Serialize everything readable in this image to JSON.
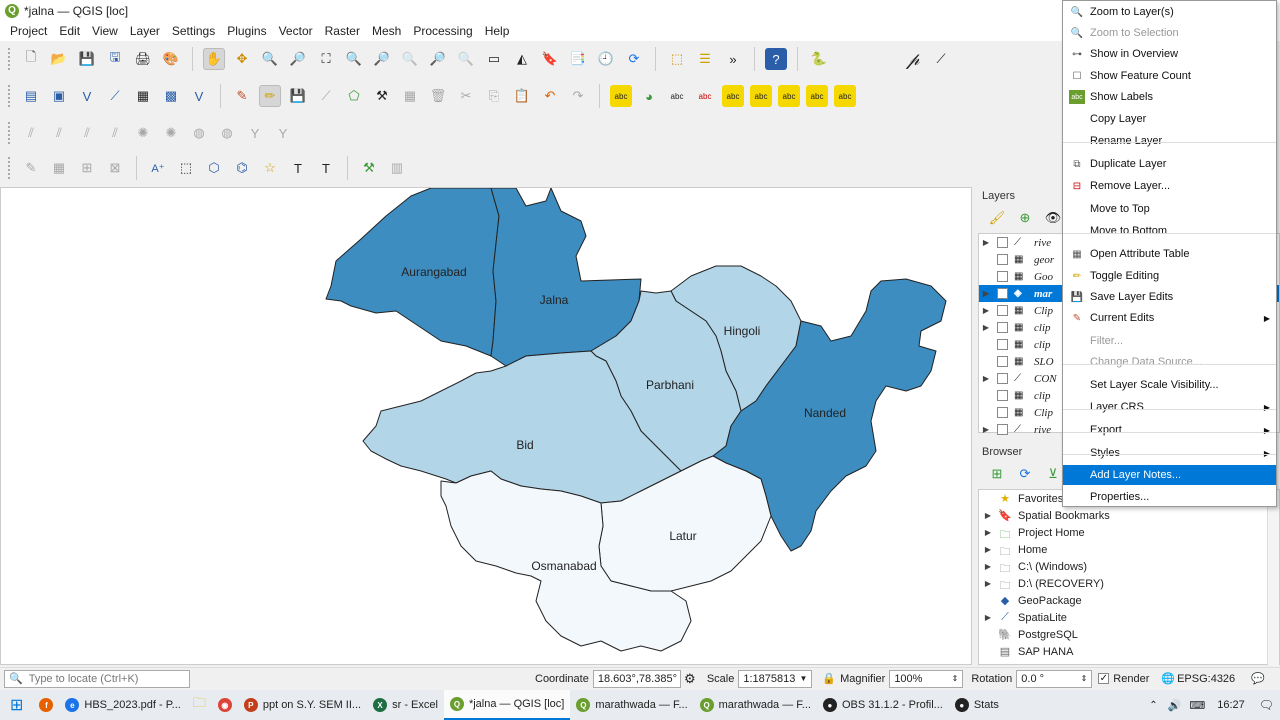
{
  "window": {
    "title": "*jalna — QGIS [loc]"
  },
  "menu": [
    "Project",
    "Edit",
    "View",
    "Layer",
    "Settings",
    "Plugins",
    "Vector",
    "Raster",
    "Mesh",
    "Processing",
    "Help"
  ],
  "map": {
    "districts": [
      {
        "name": "Aurangabad",
        "color": "#3d8dc0"
      },
      {
        "name": "Jalna",
        "color": "#3d8dc0"
      },
      {
        "name": "Hingoli",
        "color": "#b3d5e8"
      },
      {
        "name": "Parbhani",
        "color": "#b3d5e8"
      },
      {
        "name": "Nanded",
        "color": "#3d8dc0"
      },
      {
        "name": "Bid",
        "color": "#b3d5e8"
      },
      {
        "name": "Latur",
        "color": "#f3f8fc"
      },
      {
        "name": "Osmanabad",
        "color": "#f3f8fc"
      }
    ]
  },
  "layers": {
    "title": "Layers",
    "items": [
      {
        "name": "rive",
        "checked": false,
        "expand": true,
        "icon": "line"
      },
      {
        "name": "geor",
        "checked": false,
        "expand": false,
        "icon": "raster"
      },
      {
        "name": "Goo",
        "checked": false,
        "expand": false,
        "icon": "raster"
      },
      {
        "name": "mar",
        "checked": true,
        "expand": true,
        "icon": "polygon",
        "selected": true
      },
      {
        "name": "Clip",
        "checked": false,
        "expand": true,
        "icon": "raster"
      },
      {
        "name": "clip",
        "checked": false,
        "expand": true,
        "icon": "raster"
      },
      {
        "name": "clip",
        "checked": false,
        "expand": false,
        "icon": "raster"
      },
      {
        "name": "SLO",
        "checked": false,
        "expand": false,
        "icon": "raster"
      },
      {
        "name": "CON",
        "checked": false,
        "expand": true,
        "icon": "line"
      },
      {
        "name": "clip",
        "checked": false,
        "expand": false,
        "icon": "raster"
      },
      {
        "name": "Clip",
        "checked": false,
        "expand": false,
        "icon": "raster"
      },
      {
        "name": "rive",
        "checked": false,
        "expand": true,
        "icon": "line"
      }
    ]
  },
  "browser": {
    "title": "Browser",
    "items": [
      {
        "label": "Favorites",
        "expand": false,
        "icon": "star"
      },
      {
        "label": "Spatial Bookmarks",
        "expand": true,
        "icon": "bookmark"
      },
      {
        "label": "Project Home",
        "expand": true,
        "icon": "folder-green"
      },
      {
        "label": "Home",
        "expand": true,
        "icon": "folder"
      },
      {
        "label": "C:\\ (Windows)",
        "expand": true,
        "icon": "folder"
      },
      {
        "label": "D:\\ (RECOVERY)",
        "expand": true,
        "icon": "folder"
      },
      {
        "label": "GeoPackage",
        "expand": false,
        "icon": "geopackage"
      },
      {
        "label": "SpatiaLite",
        "expand": true,
        "icon": "spatialite"
      },
      {
        "label": "PostgreSQL",
        "expand": false,
        "icon": "postgres"
      },
      {
        "label": "SAP HANA",
        "expand": false,
        "icon": "database"
      }
    ]
  },
  "context_menu": {
    "items": [
      {
        "label": "Zoom to Layer(s)",
        "icon": "zoom",
        "disabled": false
      },
      {
        "label": "Zoom to Selection",
        "icon": "zoom-sel",
        "disabled": true
      },
      {
        "label": "Show in Overview",
        "icon": "overview",
        "disabled": false
      },
      {
        "label": "Show Feature Count",
        "icon": "checkbox",
        "disabled": false
      },
      {
        "label": "Show Labels",
        "icon": "labels",
        "disabled": false
      },
      {
        "label": "Copy Layer",
        "icon": "",
        "disabled": false
      },
      {
        "label": "Rename Layer",
        "icon": "",
        "disabled": false
      },
      {
        "label": "Duplicate Layer",
        "icon": "duplicate",
        "disabled": false
      },
      {
        "label": "Remove Layer...",
        "icon": "remove",
        "disabled": false
      },
      {
        "label": "Move to Top",
        "icon": "",
        "disabled": false
      },
      {
        "label": "Move to Bottom",
        "icon": "",
        "disabled": false
      },
      {
        "label": "Open Attribute Table",
        "icon": "table",
        "disabled": false
      },
      {
        "label": "Toggle Editing",
        "icon": "pencil",
        "disabled": false
      },
      {
        "label": "Save Layer Edits",
        "icon": "save",
        "disabled": false
      },
      {
        "label": "Current Edits",
        "icon": "edits",
        "disabled": false,
        "submenu": true
      },
      {
        "label": "Filter...",
        "icon": "",
        "disabled": true
      },
      {
        "label": "Change Data Source...",
        "icon": "",
        "disabled": true
      },
      {
        "label": "Set Layer Scale Visibility...",
        "icon": "",
        "disabled": false
      },
      {
        "label": "Layer CRS",
        "icon": "",
        "disabled": false,
        "submenu": true
      },
      {
        "label": "Export",
        "icon": "",
        "disabled": false,
        "submenu": true
      },
      {
        "label": "Styles",
        "icon": "",
        "disabled": false,
        "submenu": true
      },
      {
        "label": "Add Layer Notes...",
        "icon": "",
        "disabled": false,
        "highlighted": true
      },
      {
        "label": "Properties...",
        "icon": "",
        "disabled": false
      }
    ]
  },
  "statusbar": {
    "locate_placeholder": "Type to locate (Ctrl+K)",
    "coordinate_label": "Coordinate",
    "coordinate_value": "18.603°,78.385°",
    "scale_label": "Scale",
    "scale_value": "1:1875813",
    "magnifier_label": "Magnifier",
    "magnifier_value": "100%",
    "rotation_label": "Rotation",
    "rotation_value": "0.0 °",
    "render_label": "Render",
    "crs_label": "EPSG:4326"
  },
  "taskbar": {
    "apps": [
      {
        "label": "HBS_2023.pdf - P...",
        "color": "#1a73e8",
        "glyph": "e"
      },
      {
        "label": "ppt on S.Y. SEM II...",
        "color": "#c43e1c",
        "glyph": "P"
      },
      {
        "label": "sr - Excel",
        "color": "#1d6f42",
        "glyph": "X"
      },
      {
        "label": "*jalna — QGIS [loc]",
        "color": "#6a9e2f",
        "glyph": "Q",
        "active": true
      },
      {
        "label": "marathwada — F...",
        "color": "#6a9e2f",
        "glyph": "Q"
      },
      {
        "label": "marathwada — F...",
        "color": "#6a9e2f",
        "glyph": "Q"
      },
      {
        "label": "OBS 31.1.2 - Profil...",
        "color": "#222222",
        "glyph": "●"
      },
      {
        "label": "Stats",
        "color": "#222222",
        "glyph": "●"
      }
    ],
    "time": "16:27"
  }
}
